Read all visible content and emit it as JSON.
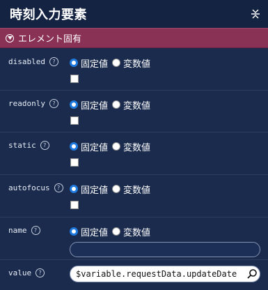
{
  "panel": {
    "title": "時刻入力要素"
  },
  "section": {
    "label": "エレメント固有"
  },
  "fixed_label": "固定値",
  "variable_label": "変数値",
  "help_glyph": "?",
  "props": [
    {
      "name": "disabled"
    },
    {
      "name": "readonly"
    },
    {
      "name": "static"
    },
    {
      "name": "autofocus"
    },
    {
      "name": "name",
      "input_value": ""
    },
    {
      "name": "value",
      "input_value": "$variable.requestData.updateDate"
    }
  ],
  "colors": {
    "section": "#8a3156",
    "radio_selected": "#1f7ae0"
  }
}
